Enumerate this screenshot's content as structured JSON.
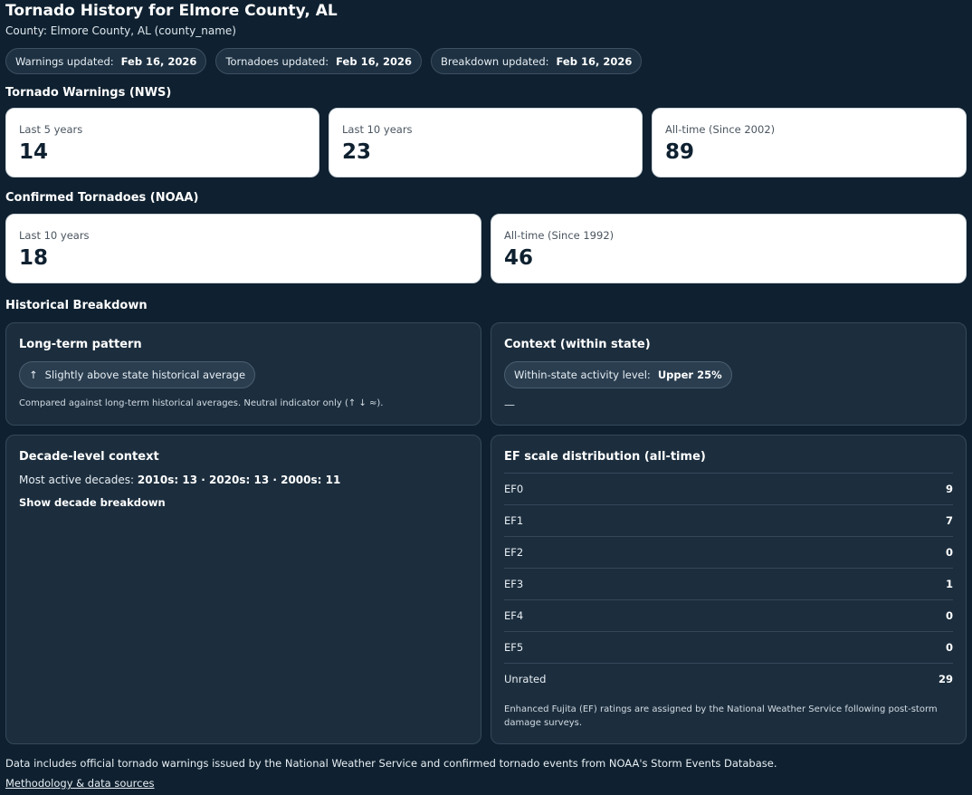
{
  "header": {
    "title": "Tornado History for Elmore County, AL",
    "county_line": "County: Elmore County, AL (county_name)"
  },
  "updates": [
    {
      "label": "Warnings updated:",
      "value": "Feb 16, 2026"
    },
    {
      "label": "Tornadoes updated:",
      "value": "Feb 16, 2026"
    },
    {
      "label": "Breakdown updated:",
      "value": "Feb 16, 2026"
    }
  ],
  "warnings": {
    "heading": "Tornado Warnings (NWS)",
    "cards": [
      {
        "label": "Last 5 years",
        "value": "14"
      },
      {
        "label": "Last 10 years",
        "value": "23"
      },
      {
        "label": "All-time (Since 2002)",
        "value": "89"
      }
    ]
  },
  "tornadoes": {
    "heading": "Confirmed Tornadoes (NOAA)",
    "cards": [
      {
        "label": "Last 10 years",
        "value": "18"
      },
      {
        "label": "All-time (Since 1992)",
        "value": "46"
      }
    ]
  },
  "breakdown": {
    "heading": "Historical Breakdown",
    "long_term": {
      "title": "Long-term pattern",
      "arrow": "↑",
      "pill": "Slightly above state historical average",
      "note": "Compared against long-term historical averages. Neutral indicator only (↑ ↓ ≈)."
    },
    "context": {
      "title": "Context (within state)",
      "pill_label": "Within-state activity level:",
      "pill_value": "Upper 25%",
      "dash": "—"
    },
    "decade": {
      "title": "Decade-level context",
      "prefix": "Most active decades:",
      "values": "2010s: 13 · 2020s: 13 · 2000s: 11",
      "toggle": "Show decade breakdown"
    },
    "ef": {
      "title": "EF scale distribution (all-time)",
      "rows": [
        {
          "label": "EF0",
          "value": "9"
        },
        {
          "label": "EF1",
          "value": "7"
        },
        {
          "label": "EF2",
          "value": "0"
        },
        {
          "label": "EF3",
          "value": "1"
        },
        {
          "label": "EF4",
          "value": "0"
        },
        {
          "label": "EF5",
          "value": "0"
        },
        {
          "label": "Unrated",
          "value": "29"
        }
      ],
      "note_line1": "Enhanced Fujita (EF) ratings are assigned by the National Weather Service following post-storm",
      "note_line2": "damage surveys."
    }
  },
  "footer": {
    "text": "Data includes official tornado warnings issued by the National Weather Service and confirmed tornado events from NOAA's Storm Events Database.",
    "link": "Methodology & data sources"
  }
}
